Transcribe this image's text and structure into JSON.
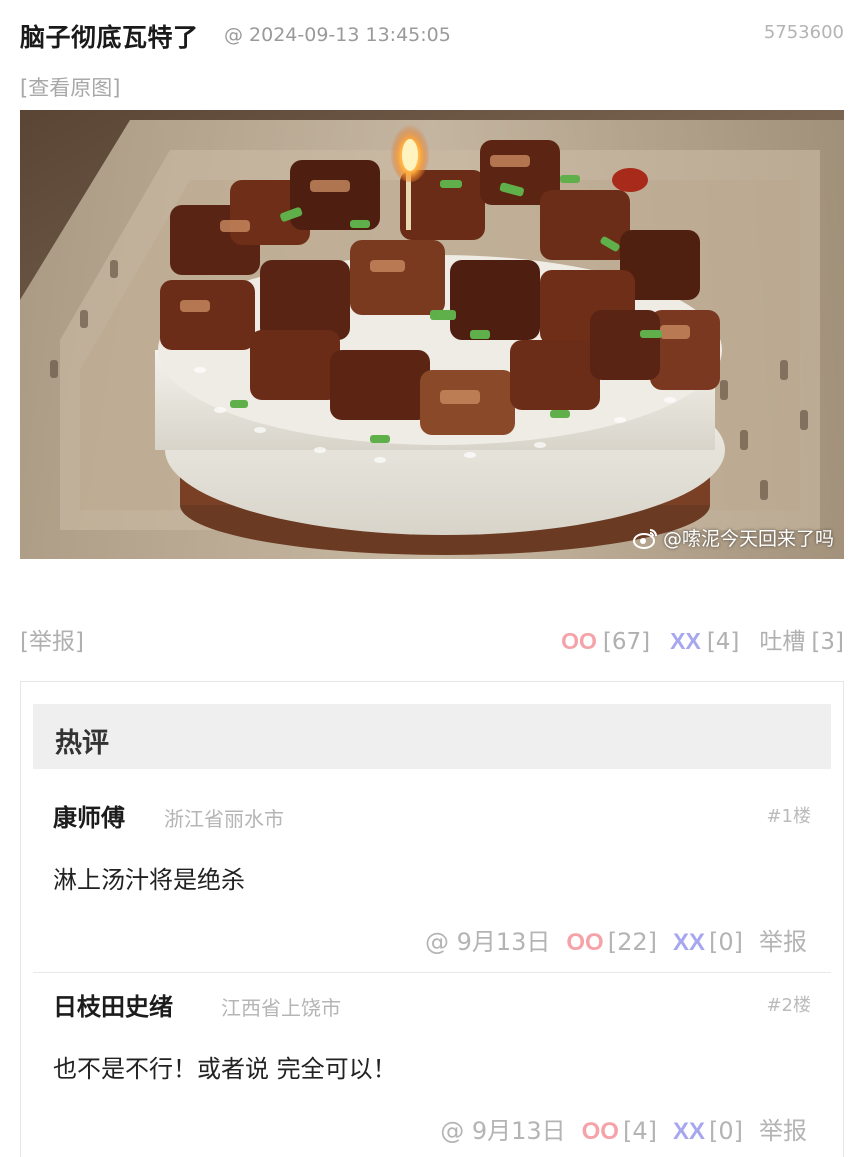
{
  "post": {
    "title": "脑子彻底瓦特了",
    "meta": "@ 2024-09-13 13:45:05",
    "id": "5753600",
    "view_original": "[查看原图]",
    "image_watermark": "@嗦泥今天回来了吗",
    "image_description_icon": "weibo-icon"
  },
  "actions": {
    "report": "[举报]",
    "oo_label": "OO",
    "oo_count": "[67]",
    "xx_label": "XX",
    "xx_count": "[4]",
    "tucao_label": "吐槽",
    "tucao_count": "[3]"
  },
  "hot": {
    "title": "热评",
    "comments": [
      {
        "author": "康师傅",
        "location": "浙江省丽水市",
        "floor": "#1楼",
        "text": "淋上汤汁将是绝杀",
        "time": "@ 9月13日",
        "oo_label": "OO",
        "oo_count": "[22]",
        "xx_label": "XX",
        "xx_count": "[0]",
        "report": "举报"
      },
      {
        "author": "日枝田史绪",
        "location": "江西省上饶市",
        "floor": "#2楼",
        "text": "也不是不行！或者说 完全可以！",
        "time": "@ 9月13日",
        "oo_label": "OO",
        "oo_count": "[4]",
        "xx_label": "XX",
        "xx_count": "[0]",
        "report": "举报"
      }
    ]
  },
  "colors": {
    "oo": "#f5a3a8",
    "xx": "#a7a7f0",
    "muted": "#b0b0b0",
    "hot_bar": "#efefef"
  }
}
